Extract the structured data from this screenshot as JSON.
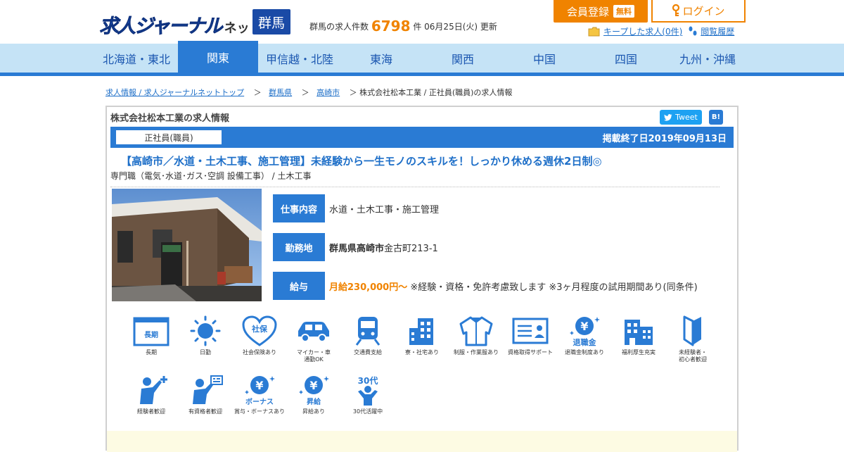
{
  "header": {
    "logo_text": "求人ジャーナル",
    "logo_suffix": "ネット",
    "prefecture_badge": "群馬",
    "job_count_prefix": "群馬の求人件数",
    "job_count_number": "6798",
    "job_count_suffix": "件 06月25日(火) 更新",
    "register_label": "会員登録",
    "register_free_badge": "無料",
    "login_label": "ログイン",
    "kept_jobs_link": "キープした求人(0件)",
    "history_link": "閲覧履歴"
  },
  "nav": {
    "items": [
      "北海道・東北",
      "関東",
      "甲信越・北陸",
      "東海",
      "関西",
      "中国",
      "四国",
      "九州・沖縄"
    ],
    "active_index": 1
  },
  "breadcrumb": {
    "items": [
      "求人情報 / 求人ジャーナルネットトップ",
      "群馬県",
      "高崎市"
    ],
    "current": "株式会社松本工業 / 正社員(職員)の求人情報",
    "separator": "＞"
  },
  "job": {
    "card_title": "株式会社松本工業の求人情報",
    "tweet_label": "Tweet",
    "hatena_label": "B!",
    "employment_type": "正社員(職員)",
    "end_date": "掲載終了日2019年09月13日",
    "headline": "【高崎市／水道・土木工事、施工管理】未経験から一生モノのスキルを！しっかり休める週休2日制◎",
    "category": "専門職（電気･水道･ガス･空調 設備工事） / 土木工事",
    "info": [
      {
        "label": "仕事内容",
        "value_bold": "",
        "value": "水道・土木工事・施工管理",
        "value_orange": ""
      },
      {
        "label": "勤務地",
        "value_bold": "群馬県高崎市",
        "value": "金古町213-1",
        "value_orange": ""
      },
      {
        "label": "給与",
        "value_bold": "",
        "value_orange": "月給230,000円～",
        "value": " ※経験・資格・免許考慮致します ※3ヶ月程度の試用期間あり(同条件)"
      }
    ]
  },
  "features": [
    {
      "label": "長期",
      "icon": "calendar-long-icon",
      "badge": "長期"
    },
    {
      "label": "日勤",
      "icon": "sun-icon",
      "badge": ""
    },
    {
      "label": "社会保険あり",
      "icon": "heart-insurance-icon",
      "badge": "社保"
    },
    {
      "label": "マイカー・車\n通勤OK",
      "icon": "car-icon",
      "badge": ""
    },
    {
      "label": "交通費支給",
      "icon": "train-icon",
      "badge": ""
    },
    {
      "label": "寮・社宅あり",
      "icon": "building-icon",
      "badge": ""
    },
    {
      "label": "制服・作業服あり",
      "icon": "uniform-icon",
      "badge": ""
    },
    {
      "label": "資格取得サポート",
      "icon": "certificate-icon",
      "badge": ""
    },
    {
      "label": "退職金制度あり",
      "icon": "retirement-yen-icon",
      "badge": "退職金"
    },
    {
      "label": "福利厚生充実",
      "icon": "welfare-building-icon",
      "badge": ""
    },
    {
      "label": "未経験者・\n初心者歓迎",
      "icon": "beginner-mark-icon",
      "badge": ""
    },
    {
      "label": "経験者歓迎",
      "icon": "experienced-person-icon",
      "badge": ""
    },
    {
      "label": "有資格者歓迎",
      "icon": "qualified-person-icon",
      "badge": ""
    },
    {
      "label": "賞与・ボーナスあり",
      "icon": "bonus-yen-icon",
      "badge": "ボーナス"
    },
    {
      "label": "昇給あり",
      "icon": "raise-yen-icon",
      "badge": "昇給"
    },
    {
      "label": "30代活躍中",
      "icon": "thirties-person-icon",
      "badge": "30代"
    }
  ],
  "colors": {
    "brand_blue": "#2a7bd4",
    "logo_blue": "#1a4aa6",
    "accent_orange": "#f08300",
    "nav_bg": "#c5e3f6"
  }
}
